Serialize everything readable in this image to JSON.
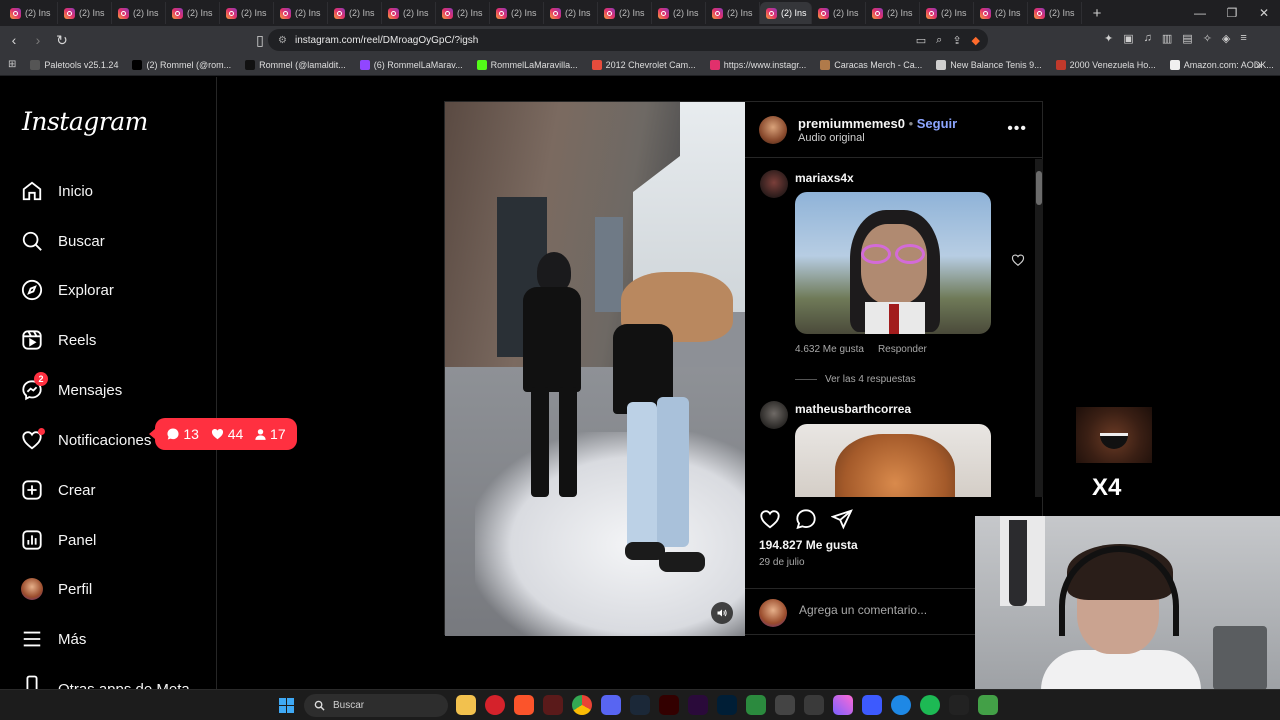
{
  "browser": {
    "tab_label": "(2) Ins",
    "tab_count": 20,
    "url": "instagram.com/reel/DMroagOyGpC/?igsh"
  },
  "bookmarks": [
    {
      "label": "Paletools v25.1.24",
      "color": "#555555"
    },
    {
      "label": "(2) Rommel (@rom...",
      "color": "#000000"
    },
    {
      "label": "Rommel (@lamaldit...",
      "color": "#111111"
    },
    {
      "label": "(6) RommelLaMarav...",
      "color": "#9146ff"
    },
    {
      "label": "RommelLaMaravilla...",
      "color": "#53fc18"
    },
    {
      "label": "2012 Chevrolet Cam...",
      "color": "#e74c3c"
    },
    {
      "label": "https://www.instagr...",
      "color": "#e1306c"
    },
    {
      "label": "Caracas Merch - Ca...",
      "color": "#b07a4a"
    },
    {
      "label": "New Balance Tenis 9...",
      "color": "#cfcfcf"
    },
    {
      "label": "2000 Venezuela Ho...",
      "color": "#c0392b"
    },
    {
      "label": "Amazon.com: AODK...",
      "color": "#f0f0f0"
    }
  ],
  "sidebar": {
    "logo": "Instagram",
    "items": [
      {
        "label": "Inicio",
        "icon": "home-icon"
      },
      {
        "label": "Buscar",
        "icon": "search-icon"
      },
      {
        "label": "Explorar",
        "icon": "compass-icon"
      },
      {
        "label": "Reels",
        "icon": "reels-icon"
      },
      {
        "label": "Mensajes",
        "icon": "messenger-icon",
        "badge": "2"
      },
      {
        "label": "Notificaciones",
        "icon": "heart-icon"
      },
      {
        "label": "Crear",
        "icon": "plus-square-icon"
      },
      {
        "label": "Panel",
        "icon": "chart-icon"
      },
      {
        "label": "Perfil",
        "icon": "avatar"
      },
      {
        "label": "Más",
        "icon": "menu-icon"
      },
      {
        "label": "Otras apps de Meta",
        "icon": "meta-icon"
      }
    ]
  },
  "notification_pill": {
    "comments": "13",
    "likes": "44",
    "followers": "17",
    "color": "#ff3040"
  },
  "post": {
    "author": "premiummemes0",
    "separator": "•",
    "follow_label": "Seguir",
    "audio": "Audio original",
    "comments": [
      {
        "user": "mariaxs4x",
        "likes": "4.632 Me gusta",
        "reply_label": "Responder",
        "replies": "Ver las 4 respuestas"
      },
      {
        "user": "matheusbarthcorrea"
      }
    ],
    "likes_count": "194.827 Me gusta",
    "date": "29 de julio",
    "comment_placeholder": "Agrega un comentario..."
  },
  "overlay": {
    "multiplier": "X4"
  },
  "taskbar": {
    "search_label": "Buscar"
  },
  "colors": {
    "accent_link": "#8da6ff",
    "badge_red": "#ff3040",
    "background": "#000000"
  }
}
